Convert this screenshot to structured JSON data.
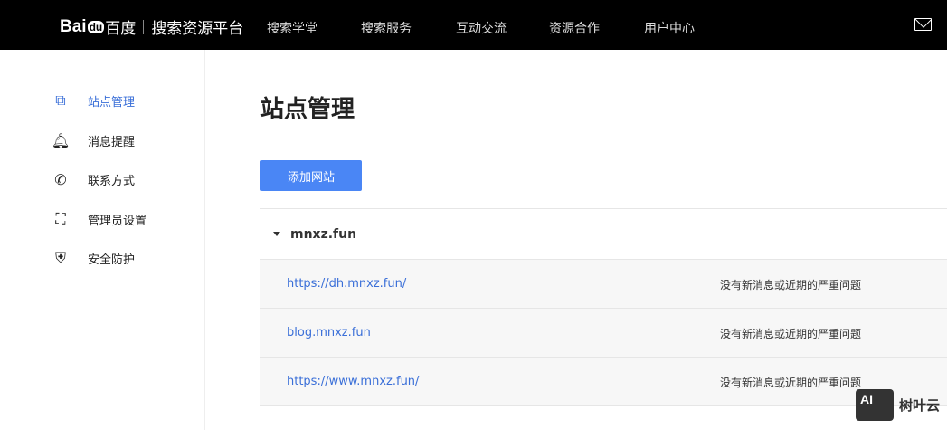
{
  "header": {
    "logo_latin": "Bai",
    "logo_paw": "du",
    "logo_cn": "百度",
    "platform": "搜索资源平台",
    "nav": [
      "搜索学堂",
      "搜索服务",
      "互动交流",
      "资源合作",
      "用户中心"
    ]
  },
  "sidebar": {
    "items": [
      {
        "label": "站点管理",
        "icon": "sitemap-icon"
      },
      {
        "label": "消息提醒",
        "icon": "bell-icon"
      },
      {
        "label": "联系方式",
        "icon": "phone-icon"
      },
      {
        "label": "管理员设置",
        "icon": "admin-icon"
      },
      {
        "label": "安全防护",
        "icon": "shield-icon"
      }
    ]
  },
  "main": {
    "title": "站点管理",
    "add_button": "添加网站",
    "group": {
      "name": "mnxz.fun",
      "sites": [
        {
          "url": "https://dh.mnxz.fun/",
          "status": "没有新消息或近期的严重问题"
        },
        {
          "url": "blog.mnxz.fun",
          "status": "没有新消息或近期的严重问题"
        },
        {
          "url": "https://www.mnxz.fun/",
          "status": "没有新消息或近期的严重问题"
        }
      ]
    }
  },
  "watermark": {
    "badge": "AI",
    "text": "树叶云"
  }
}
